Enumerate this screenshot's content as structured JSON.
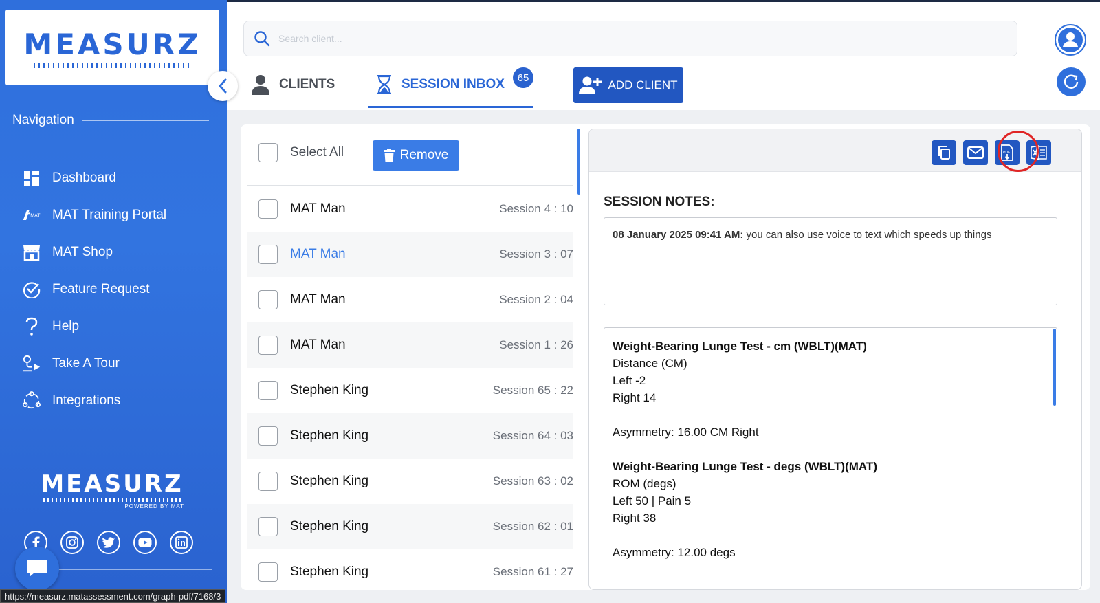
{
  "brand": {
    "logo_text": "MEASURZ",
    "footer_logo_text": "MEASURZ",
    "powered_by": "POWERED BY MAT",
    "colors": {
      "primary": "#2f6fdc",
      "dark_button": "#2257c1",
      "highlight_ring": "#e02525"
    }
  },
  "sidebar": {
    "nav_title": "Navigation",
    "items": [
      {
        "label": "Dashboard",
        "icon": "dashboard-grid-icon"
      },
      {
        "label": "MAT Training Portal",
        "icon": "mat-logo-icon"
      },
      {
        "label": "MAT Shop",
        "icon": "shop-icon"
      },
      {
        "label": "Feature Request",
        "icon": "check-circle-icon"
      },
      {
        "label": "Help",
        "icon": "question-icon"
      },
      {
        "label": "Take A Tour",
        "icon": "tour-route-icon"
      },
      {
        "label": "Integrations",
        "icon": "integrations-icon"
      }
    ],
    "socials": [
      "facebook-icon",
      "instagram-icon",
      "twitter-icon",
      "youtube-icon",
      "linkedin-icon"
    ]
  },
  "header": {
    "search_placeholder": "Search client...",
    "tabs": [
      {
        "label": "CLIENTS",
        "active": false
      },
      {
        "label": "SESSION INBOX",
        "active": true,
        "badge": "65"
      }
    ],
    "add_client_label": "ADD CLIENT"
  },
  "inbox": {
    "select_all_label": "Select All",
    "remove_label": "Remove",
    "rows": [
      {
        "name": "MAT Man",
        "session": "Session 4 : 10",
        "selected": false
      },
      {
        "name": "MAT Man",
        "session": "Session 3 : 07",
        "selected": true
      },
      {
        "name": "MAT Man",
        "session": "Session 2 : 04",
        "selected": false
      },
      {
        "name": "MAT Man",
        "session": "Session 1 : 26",
        "selected": false
      },
      {
        "name": "Stephen King",
        "session": "Session 65 : 22",
        "selected": false
      },
      {
        "name": "Stephen King",
        "session": "Session 64 : 03",
        "selected": false
      },
      {
        "name": "Stephen King",
        "session": "Session 63 : 02",
        "selected": false
      },
      {
        "name": "Stephen King",
        "session": "Session 62 : 01",
        "selected": false
      },
      {
        "name": "Stephen King",
        "session": "Session 61 : 27",
        "selected": false
      }
    ]
  },
  "detail": {
    "toolbar": [
      "copy-icon",
      "email-icon",
      "pdf-export-icon",
      "excel-export-icon"
    ],
    "notes_label": "SESSION NOTES:",
    "note_timestamp": "08 January 2025 09:41 AM:",
    "note_text": " you can also use voice to text which speeds up things",
    "tests": [
      {
        "title": "Weight-Bearing Lunge Test - cm (WBLT)(MAT)",
        "measure": "Distance (CM)",
        "left": "Left -2",
        "right": "Right 14",
        "asymmetry": "Asymmetry: 16.00 CM Right"
      },
      {
        "title": "Weight-Bearing Lunge Test - degs (WBLT)(MAT)",
        "measure": "ROM (degs)",
        "left": "Left 50 | Pain 5",
        "right": "Right 38",
        "asymmetry": "Asymmetry: 12.00 degs"
      }
    ]
  },
  "status_bar": {
    "url": "https://measurz.matassessment.com/graph-pdf/7168/3"
  }
}
